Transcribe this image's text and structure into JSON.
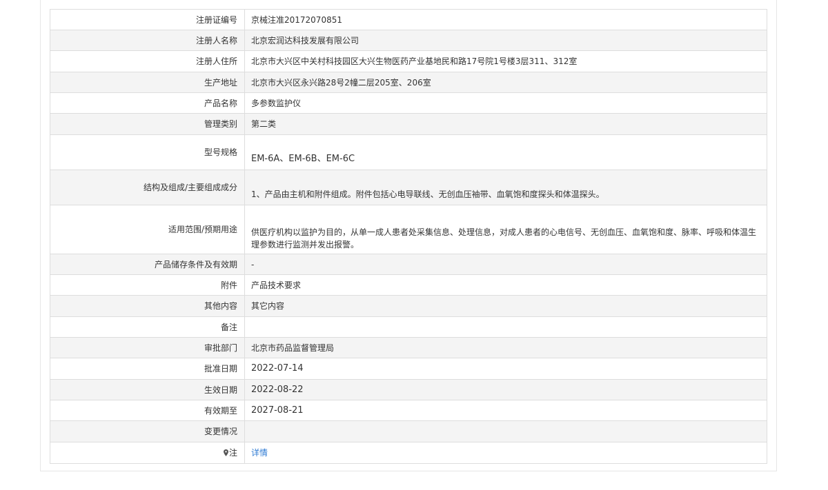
{
  "rows": [
    {
      "label": "注册证编号",
      "value": "京械注准20172070851"
    },
    {
      "label": "注册人名称",
      "value": "北京宏润达科技发展有限公司"
    },
    {
      "label": "注册人住所",
      "value": "北京市大兴区中关村科技园区大兴生物医药产业基地民和路17号院1号楼3层311、312室"
    },
    {
      "label": "生产地址",
      "value": "北京市大兴区永兴路28号2幢二层205室、206室"
    },
    {
      "label": "产品名称",
      "value": "多参数监护仪"
    },
    {
      "label": "管理类别",
      "value": "第二类"
    },
    {
      "label": "型号规格",
      "value": "EM-6A、EM-6B、EM-6C"
    },
    {
      "label": "结构及组成/主要组成成分",
      "value": "1、产品由主机和附件组成。附件包括心电导联线、无创血压袖带、血氧饱和度探头和体温探头。"
    },
    {
      "label": "适用范围/预期用途",
      "value": "供医疗机构以监护为目的，从单一成人患者处采集信息、处理信息，对成人患者的心电信号、无创血压、血氧饱和度、脉率、呼吸和体温生理参数进行监测并发出报警。"
    },
    {
      "label": "产品储存条件及有效期",
      "value": "-"
    },
    {
      "label": "附件",
      "value": "产品技术要求"
    },
    {
      "label": "其他内容",
      "value": "其它内容"
    },
    {
      "label": "备注",
      "value": ""
    },
    {
      "label": "审批部门",
      "value": "北京市药品监督管理局"
    },
    {
      "label": "批准日期",
      "value": "2022-07-14"
    },
    {
      "label": "生效日期",
      "value": "2022-08-22"
    },
    {
      "label": "有效期至",
      "value": "2027-08-21"
    },
    {
      "label": "变更情况",
      "value": ""
    },
    {
      "label": "注",
      "value": "详情"
    }
  ],
  "colors": {
    "link": "#2f7bd3",
    "stripe": "#f4f4f4",
    "border": "#dddddd"
  },
  "icons": {
    "note": "map-pin-icon"
  }
}
